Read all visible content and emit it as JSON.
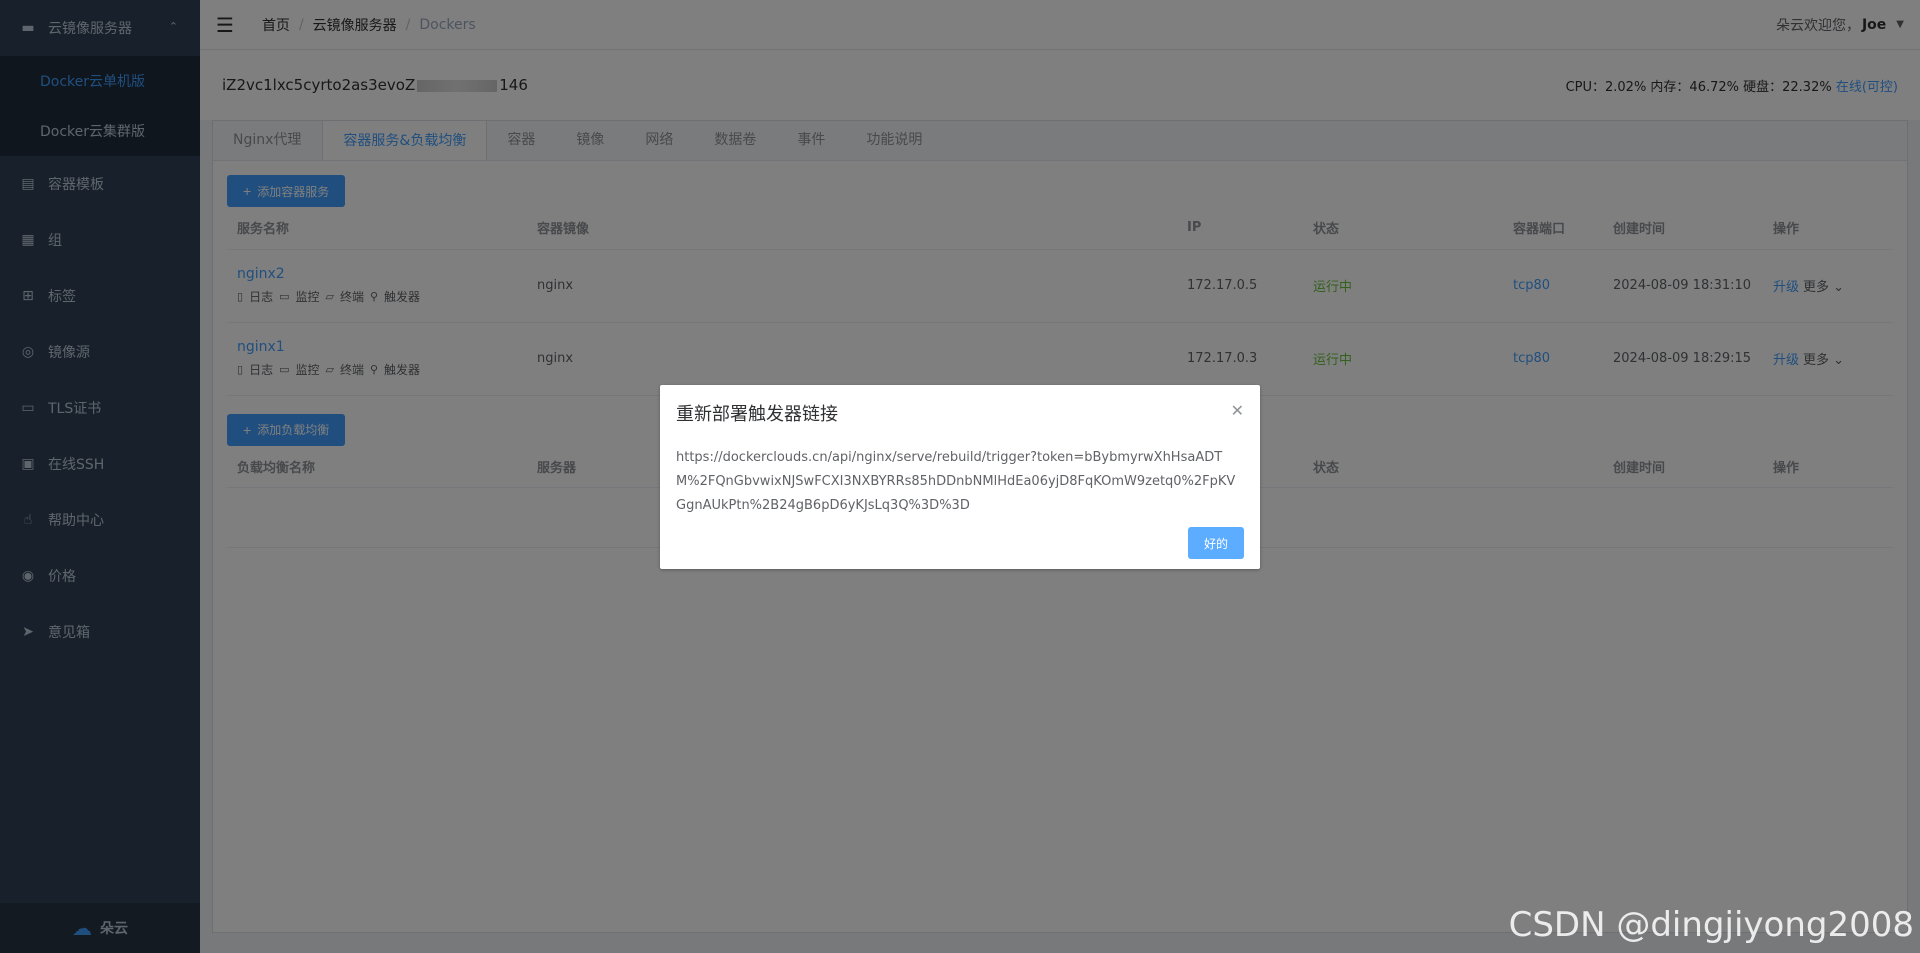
{
  "sidebar": {
    "group_title": "云镜像服务器",
    "sub_items": [
      "Docker云单机版",
      "Docker云集群版"
    ],
    "items": [
      {
        "label": "容器模板",
        "icon": "document-icon"
      },
      {
        "label": "组",
        "icon": "grid-icon"
      },
      {
        "label": "标签",
        "icon": "apps-icon"
      },
      {
        "label": "镜像源",
        "icon": "database-icon"
      },
      {
        "label": "TLS证书",
        "icon": "ticket-icon"
      },
      {
        "label": "在线SSH",
        "icon": "terminal-icon"
      },
      {
        "label": "帮助中心",
        "icon": "pointer-icon"
      },
      {
        "label": "价格",
        "icon": "eye-icon"
      },
      {
        "label": "意见箱",
        "icon": "send-icon"
      }
    ],
    "footer_label": "朵云"
  },
  "header": {
    "breadcrumb": [
      "首页",
      "云镜像服务器",
      "Dockers"
    ],
    "welcome": "朵云欢迎您，",
    "username": "Joe"
  },
  "host": {
    "id_prefix": "iZ2vc1lxc5cyrto2as3evoZ",
    "id_suffix": "146",
    "stats": "CPU：2.02% 内存：46.72% 硬盘：22.32%",
    "online": "在线(可控)"
  },
  "tabs": [
    "Nginx代理",
    "容器服务&负载均衡",
    "容器",
    "镜像",
    "网络",
    "数据卷",
    "事件",
    "功能说明"
  ],
  "services": {
    "add_label": "添加容器服务",
    "columns": [
      "服务名称",
      "容器镜像",
      "IP",
      "状态",
      "容器端口",
      "创建时间",
      "操作"
    ],
    "row_actions": [
      "日志",
      "监控",
      "终端",
      "触发器"
    ],
    "rows": [
      {
        "name": "nginx2",
        "image": "nginx",
        "ip": "172.17.0.5",
        "status": "运行中",
        "port": "tcp80",
        "created": "2024-08-09 18:31:10",
        "upgrade": "升级",
        "more": "更多"
      },
      {
        "name": "nginx1",
        "image": "nginx",
        "ip": "172.17.0.3",
        "status": "运行中",
        "port": "tcp80",
        "created": "2024-08-09 18:29:15",
        "upgrade": "升级",
        "more": "更多"
      }
    ]
  },
  "loadbalance": {
    "add_label": "添加负载均衡",
    "columns": [
      "负载均衡名称",
      "服务器",
      "状态",
      "创建时间",
      "操作"
    ]
  },
  "dialog": {
    "title": "重新部署触发器链接",
    "url": "https://dockerclouds.cn/api/nginx/serve/rebuild/trigger?token=bBybmyrwXhHsaADTM%2FQnGbvwixNJSwFCXI3NXBYRRs85hDDnbNMlHdEa06yjD8FqKOmW9zetq0%2FpKVGgnAUkPtn%2B24gB6pD6yKJsLq3Q%3D%3D",
    "ok_label": "好的"
  },
  "watermark": "CSDN @dingjiyong2008"
}
